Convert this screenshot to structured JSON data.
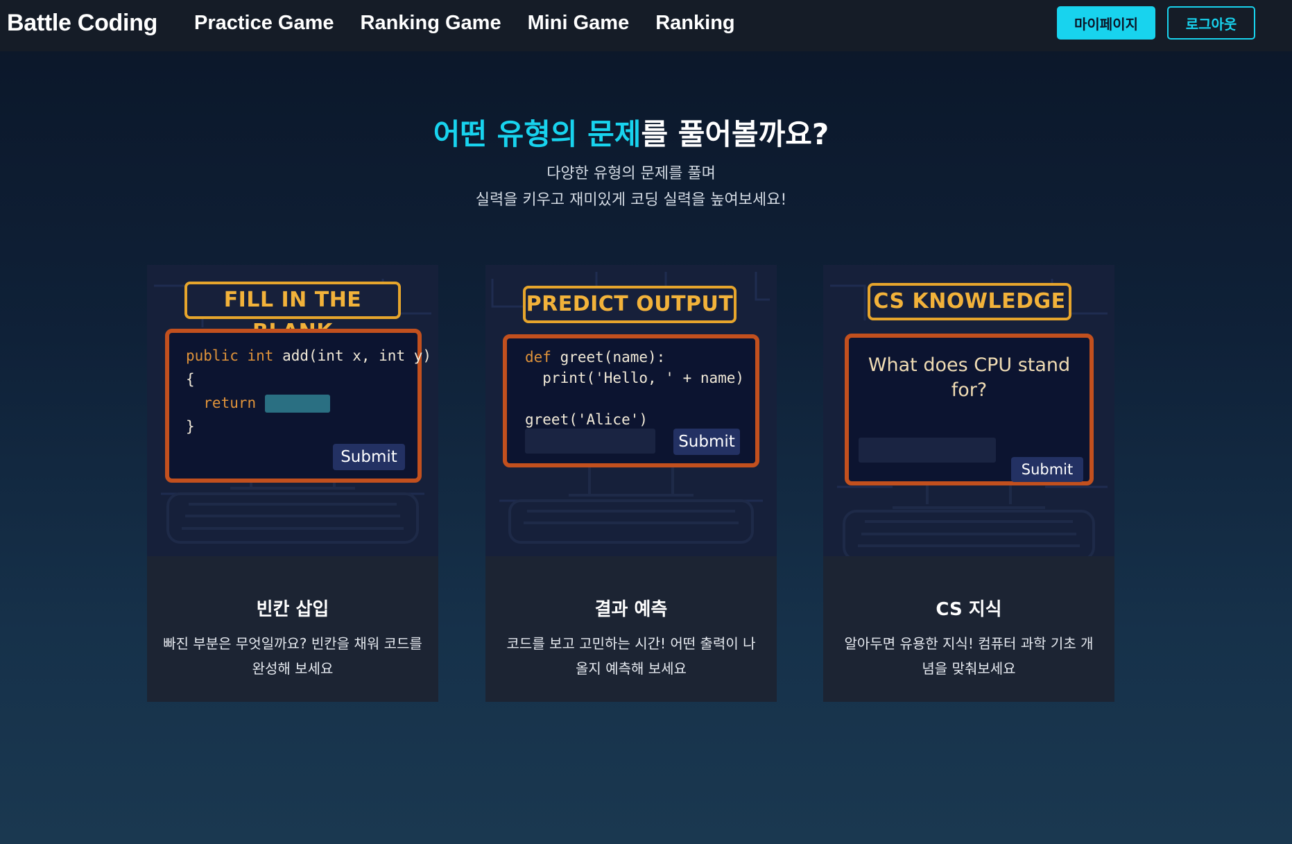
{
  "nav": {
    "brand": "Battle Coding",
    "links": [
      "Practice Game",
      "Ranking Game",
      "Mini Game",
      "Ranking"
    ],
    "mypage_label": "마이페이지",
    "logout_label": "로그아웃"
  },
  "hero": {
    "title_highlight": "어떤 유형의 문제",
    "title_rest": "를 풀어볼까요?",
    "subtitle_line1": "다양한 유형의 문제를 풀며",
    "subtitle_line2": "실력을 키우고 재미있게 코딩 실력을 높여보세요!"
  },
  "colors": {
    "accent": "#18d3ee",
    "banner": "#e6a52c",
    "monitor_frame": "#c2501e",
    "card_bg": "#1c2433"
  },
  "cards": [
    {
      "banner": "FILL IN THE BLANK",
      "code": {
        "line1_kw": "public int",
        "line1_tx": " add(int x, int y)",
        "line2": "{",
        "line3_kw": "  return",
        "line4": "}"
      },
      "submit": "Submit",
      "title": "빈칸 삽입",
      "desc": "빠진 부분은 무엇일까요? 빈칸을 채워 코드를 완성해 보세요"
    },
    {
      "banner": "PREDICT OUTPUT",
      "code": {
        "line1_kw": "def",
        "line1_tx": " greet(name):",
        "line2": "  print('Hello, ' + name)",
        "line3": "greet('Alice')"
      },
      "submit": "Submit",
      "title": "결과 예측",
      "desc": "코드를 보고 고민하는 시간! 어떤 출력이 나올지 예측해 보세요"
    },
    {
      "banner": "CS KNOWLEDGE",
      "question": "What does CPU stand for?",
      "submit": "Submit",
      "title": "CS 지식",
      "desc": "알아두면 유용한 지식! 컴퓨터 과학 기초 개념을 맞춰보세요"
    }
  ]
}
